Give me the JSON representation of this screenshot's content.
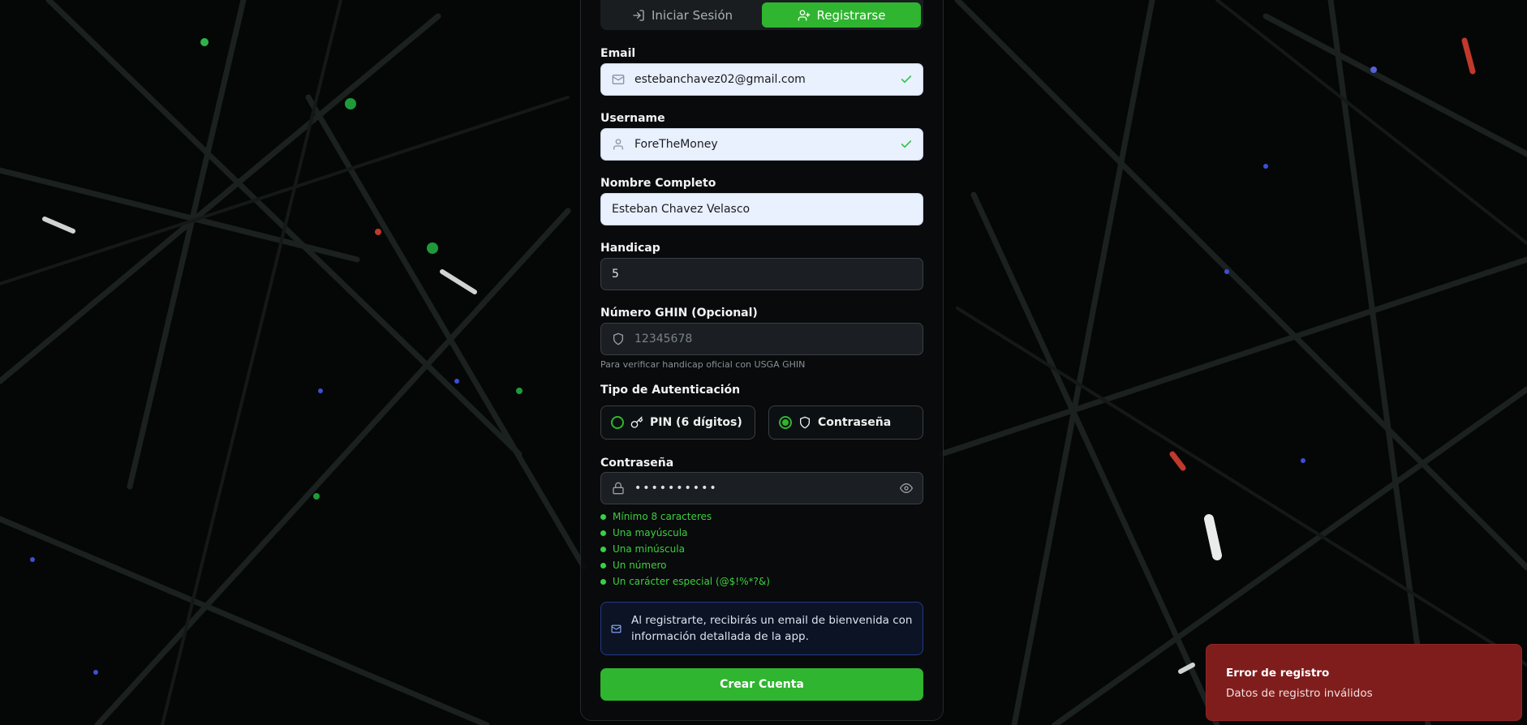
{
  "tabs": {
    "login": "Iniciar Sesión",
    "register": "Registrarse"
  },
  "form": {
    "email": {
      "label": "Email",
      "value": "estebanchavez02@gmail.com"
    },
    "username": {
      "label": "Username",
      "value": "ForeTheMoney"
    },
    "full_name": {
      "label": "Nombre Completo",
      "value": "Esteban Chavez Velasco"
    },
    "handicap": {
      "label": "Handicap",
      "value": "5"
    },
    "ghin": {
      "label": "Número GHIN (Opcional)",
      "placeholder": "12345678",
      "hint": "Para verificar handicap oficial con USGA GHIN"
    },
    "auth_type": {
      "label": "Tipo de Autenticación",
      "options": [
        "PIN (6 dígitos)",
        "Contraseña"
      ],
      "selected": "Contraseña"
    },
    "password": {
      "label": "Contraseña",
      "value": "••••••••••"
    },
    "requirements": [
      "Mínimo 8 caracteres",
      "Una mayúscula",
      "Una minúscula",
      "Un número",
      "Un carácter especial (@$!%*?&)"
    ],
    "info_text": "Al registrarte, recibirás un email de bienvenida con información detallada de la app.",
    "submit_label": "Crear Cuenta"
  },
  "toast": {
    "title": "Error de registro",
    "message": "Datos de registro inválidos"
  },
  "colors": {
    "accent": "#2fb52f",
    "valid": "#3ecf3e",
    "error": "#7f1d1d",
    "info_border": "#233b8a"
  }
}
